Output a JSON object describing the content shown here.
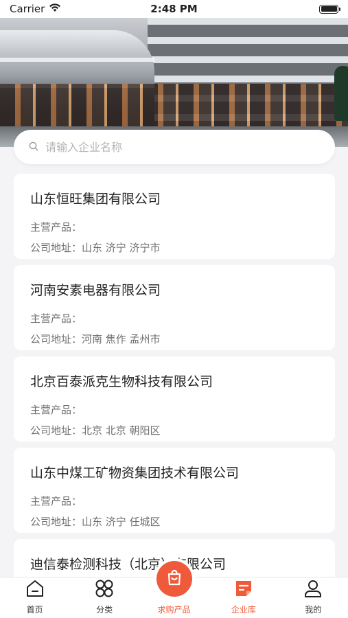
{
  "status_bar": {
    "carrier": "Carrier",
    "time": "2:48 PM"
  },
  "search": {
    "placeholder": "请输入企业名称"
  },
  "labels": {
    "main_products": "主营产品：",
    "address": "公司地址："
  },
  "companies": [
    {
      "name": "山东恒旺集团有限公司",
      "products": "",
      "address": "山东 济宁 济宁市"
    },
    {
      "name": "河南安素电器有限公司",
      "products": "",
      "address": "河南 焦作 孟州市"
    },
    {
      "name": "北京百泰派克生物科技有限公司",
      "products": "",
      "address": "北京 北京 朝阳区"
    },
    {
      "name": "山东中煤工矿物资集团技术有限公司",
      "products": "",
      "address": "山东 济宁 任城区"
    },
    {
      "name": "迪信泰检测科技（北京）有限公司",
      "products": "",
      "address": ""
    }
  ],
  "tabbar": {
    "items": [
      {
        "label": "首页",
        "icon": "home-icon"
      },
      {
        "label": "分类",
        "icon": "category-icon"
      },
      {
        "label": "求购产品",
        "icon": "shopping-bag-icon"
      },
      {
        "label": "企业库",
        "icon": "enterprise-icon"
      },
      {
        "label": "我的",
        "icon": "user-icon"
      }
    ],
    "active_index": 3
  },
  "colors": {
    "accent": "#ee5a3a",
    "background": "#f4f4f6"
  }
}
